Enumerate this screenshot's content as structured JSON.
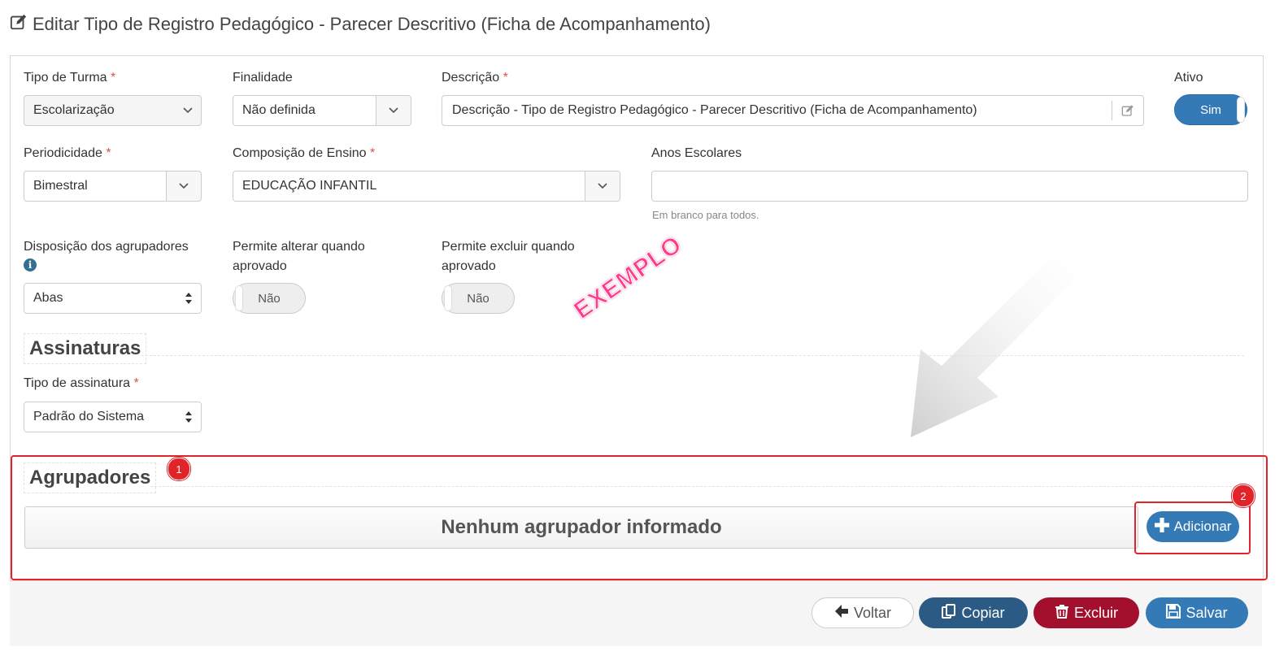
{
  "header": {
    "title": "Editar Tipo de Registro Pedagógico - Parecer Descritivo (Ficha de Acompanhamento)",
    "icon": "edit-icon"
  },
  "form": {
    "tipo_turma": {
      "label": "Tipo de Turma",
      "required": "*",
      "value": "Escolarização"
    },
    "finalidade": {
      "label": "Finalidade",
      "value": "Não definida"
    },
    "descricao": {
      "label": "Descrição",
      "required": "*",
      "value": "Descrição - Tipo de Registro Pedagógico - Parecer Descritivo (Ficha de Acompanhamento)"
    },
    "ativo": {
      "label": "Ativo",
      "value": "Sim"
    },
    "periodicidade": {
      "label": "Periodicidade",
      "required": "*",
      "value": "Bimestral"
    },
    "composicao": {
      "label": "Composição de Ensino",
      "required": "*",
      "value": "EDUCAÇÃO INFANTIL"
    },
    "anos_escolares": {
      "label": "Anos Escolares",
      "value": "",
      "hint": "Em branco para todos."
    },
    "disposicao": {
      "label": "Disposição dos agrupadores",
      "value": "Abas"
    },
    "permite_alterar": {
      "label_line1": "Permite alterar quando",
      "label_line2": "aprovado",
      "value": "Não"
    },
    "permite_excluir": {
      "label_line1": "Permite excluir quando",
      "label_line2": "aprovado",
      "value": "Não"
    }
  },
  "assinaturas": {
    "title": "Assinaturas",
    "tipo": {
      "label": "Tipo de assinatura",
      "required": "*",
      "value": "Padrão do Sistema"
    }
  },
  "agrupadores": {
    "title": "Agrupadores",
    "empty_text": "Nenhum agrupador informado",
    "add_label": "Adicionar"
  },
  "annotations": {
    "badge1": "1",
    "badge2": "2",
    "watermark": "EXEMPLO"
  },
  "footer": {
    "back": "Voltar",
    "copy": "Copiar",
    "delete": "Excluir",
    "save": "Salvar"
  },
  "colors": {
    "primary": "#337ab7",
    "dark": "#2b5a85",
    "danger": "#a3102e",
    "highlight": "#e0242a",
    "watermark": "#ff3b8c"
  }
}
